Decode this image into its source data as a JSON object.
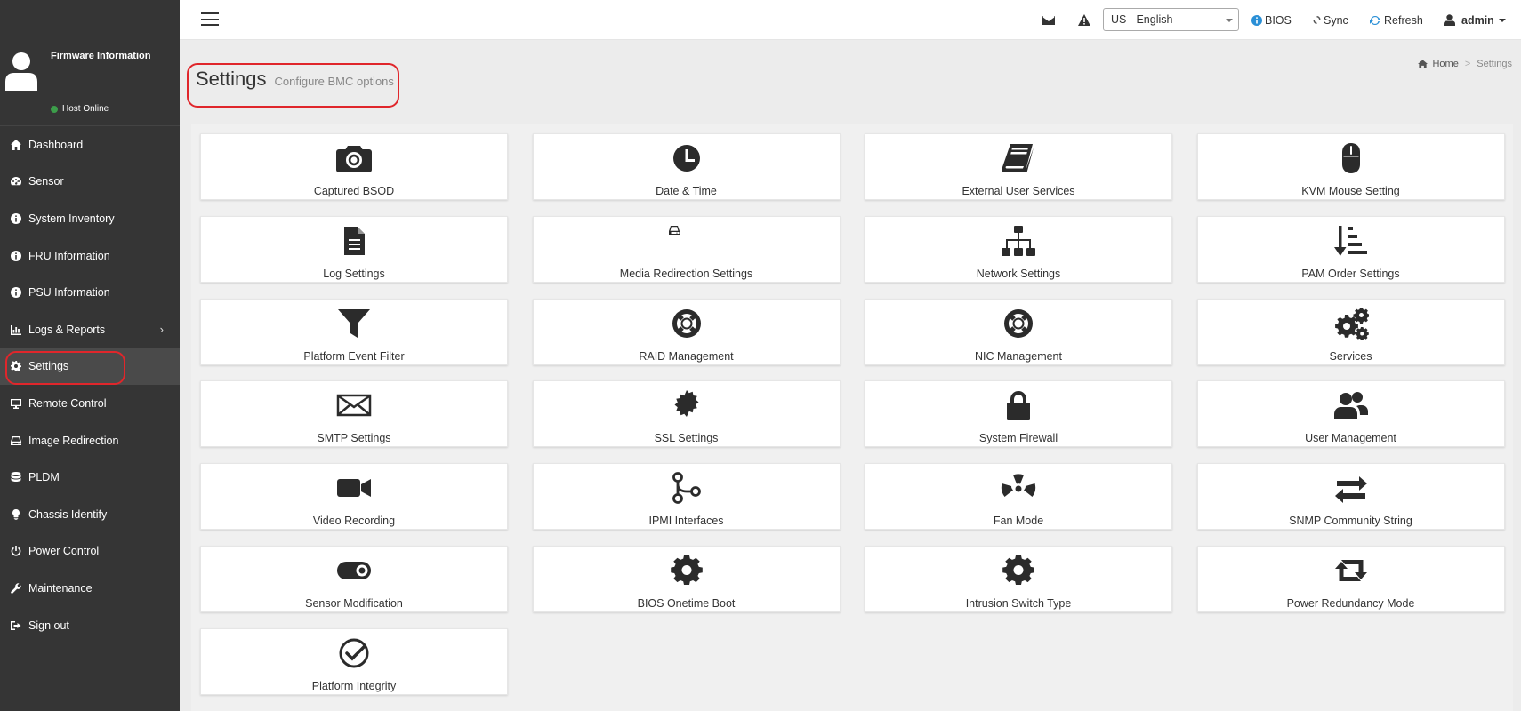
{
  "sidebar": {
    "firmware_link": "Firmware Information",
    "host_status": "Host Online",
    "items": [
      {
        "label": "Dashboard",
        "icon": "home-icon"
      },
      {
        "label": "Sensor",
        "icon": "dashboard-icon"
      },
      {
        "label": "System Inventory",
        "icon": "info-icon"
      },
      {
        "label": "FRU Information",
        "icon": "info-icon"
      },
      {
        "label": "PSU Information",
        "icon": "info-icon"
      },
      {
        "label": "Logs & Reports",
        "icon": "bar-chart-icon"
      },
      {
        "label": "Settings",
        "icon": "gear-icon"
      },
      {
        "label": "Remote Control",
        "icon": "monitor-icon"
      },
      {
        "label": "Image Redirection",
        "icon": "hdd-icon"
      },
      {
        "label": "PLDM",
        "icon": "database-icon"
      },
      {
        "label": "Chassis Identify",
        "icon": "lightbulb-icon"
      },
      {
        "label": "Power Control",
        "icon": "power-icon"
      },
      {
        "label": "Maintenance",
        "icon": "wrench-icon"
      },
      {
        "label": "Sign out",
        "icon": "sign-out-icon"
      }
    ]
  },
  "topbar": {
    "language": "US - English",
    "bios": "BIOS",
    "sync": "Sync",
    "refresh": "Refresh",
    "user": "admin"
  },
  "header": {
    "title": "Settings",
    "subtitle": "Configure BMC options"
  },
  "breadcrumb": {
    "home": "Home",
    "sep": ">",
    "current": "Settings"
  },
  "tiles": [
    {
      "label": "Captured BSOD",
      "icon": "camera-icon"
    },
    {
      "label": "Date & Time",
      "icon": "clock-icon"
    },
    {
      "label": "External User Services",
      "icon": "book-icon"
    },
    {
      "label": "KVM Mouse Setting",
      "icon": "mouse-icon"
    },
    {
      "label": "Log Settings",
      "icon": "file-text-icon"
    },
    {
      "label": "Media Redirection Settings",
      "icon": "hdd-icon"
    },
    {
      "label": "Network Settings",
      "icon": "sitemap-icon"
    },
    {
      "label": "PAM Order Settings",
      "icon": "sort-amount-icon"
    },
    {
      "label": "Platform Event Filter",
      "icon": "filter-icon"
    },
    {
      "label": "RAID Management",
      "icon": "life-ring-icon"
    },
    {
      "label": "NIC Management",
      "icon": "life-ring-icon"
    },
    {
      "label": "Services",
      "icon": "gears-icon"
    },
    {
      "label": "SMTP Settings",
      "icon": "envelope-icon"
    },
    {
      "label": "SSL Settings",
      "icon": "certificate-icon"
    },
    {
      "label": "System Firewall",
      "icon": "lock-icon"
    },
    {
      "label": "User Management",
      "icon": "users-icon"
    },
    {
      "label": "Video Recording",
      "icon": "video-camera-icon"
    },
    {
      "label": "IPMI Interfaces",
      "icon": "code-fork-icon"
    },
    {
      "label": "Fan Mode",
      "icon": "radiation-icon"
    },
    {
      "label": "SNMP Community String",
      "icon": "exchange-icon"
    },
    {
      "label": "Sensor Modification",
      "icon": "toggle-icon"
    },
    {
      "label": "BIOS Onetime Boot",
      "icon": "gear-icon"
    },
    {
      "label": "Intrusion Switch Type",
      "icon": "gear-icon"
    },
    {
      "label": "Power Redundancy Mode",
      "icon": "retweet-icon"
    },
    {
      "label": "Platform Integrity",
      "icon": "check-circle-icon"
    }
  ],
  "colors": {
    "sidebar_bg": "#353535",
    "sidebar_active": "#4a4a4a",
    "highlight": "#e0262b",
    "host_online": "#3c9d4a",
    "bios_icon": "#2a8fd6",
    "refresh_icon": "#2a8fd6"
  }
}
